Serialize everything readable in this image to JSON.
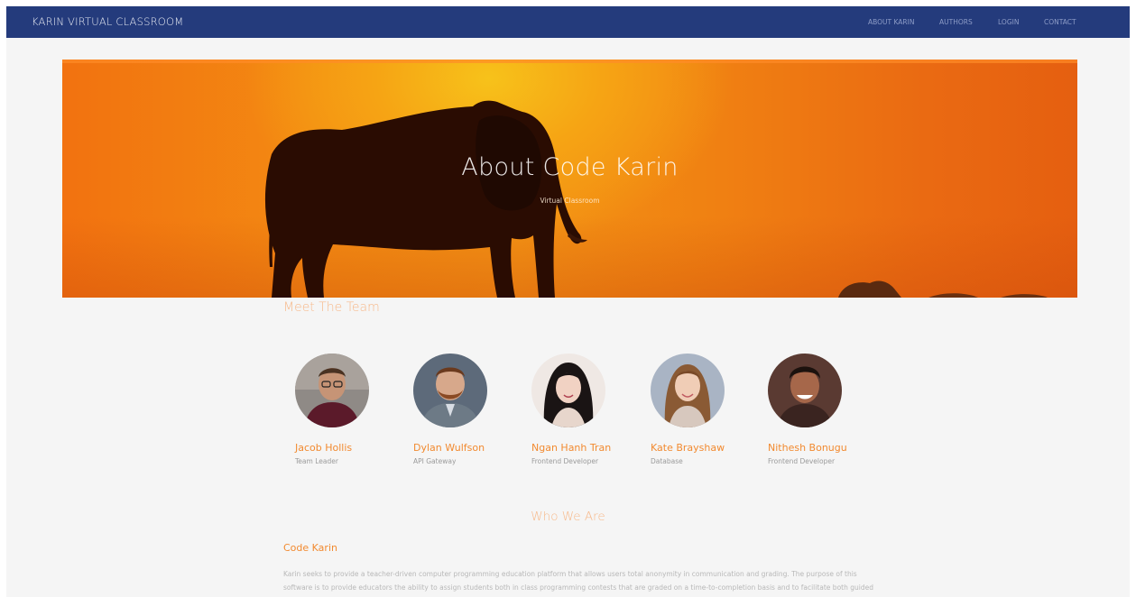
{
  "nav": {
    "brand": "KARIN VIRTUAL CLASSROOM",
    "links": [
      "ABOUT KARIN",
      "AUTHORS",
      "LOGIN",
      "CONTACT"
    ]
  },
  "hero": {
    "title": "About Code Karin",
    "subtitle": "Virtual Classroom"
  },
  "team": {
    "heading": "Meet The Team",
    "members": [
      {
        "name": "Jacob Hollis",
        "role": "Team Leader",
        "avatar_icon": "person-photo-avatar"
      },
      {
        "name": "Dylan Wulfson",
        "role": "API Gateway",
        "avatar_icon": "person-photo-avatar"
      },
      {
        "name": "Ngan Hanh Tran",
        "role": "Frontend Developer",
        "avatar_icon": "person-photo-avatar"
      },
      {
        "name": "Kate Brayshaw",
        "role": "Database",
        "avatar_icon": "person-photo-avatar"
      },
      {
        "name": "Nithesh Bonugu",
        "role": "Frontend Developer",
        "avatar_icon": "person-photo-avatar"
      }
    ]
  },
  "who": {
    "heading": "Who We Are",
    "title": "Code Karin",
    "text": "Karin seeks to provide a teacher-driven computer programming education platform that allows users total anonymity in communication and grading. The purpose of this software is to provide educators the ability to assign students both in class programming contests that are graded on a time-to-completion basis and to facilitate both guided and collaborative communication about programming and computer software."
  },
  "colors": {
    "navbar": "#243b7c",
    "accent": "#f28a30",
    "accent_light": "#f7b98a",
    "page_bg": "#f5f5f5"
  }
}
